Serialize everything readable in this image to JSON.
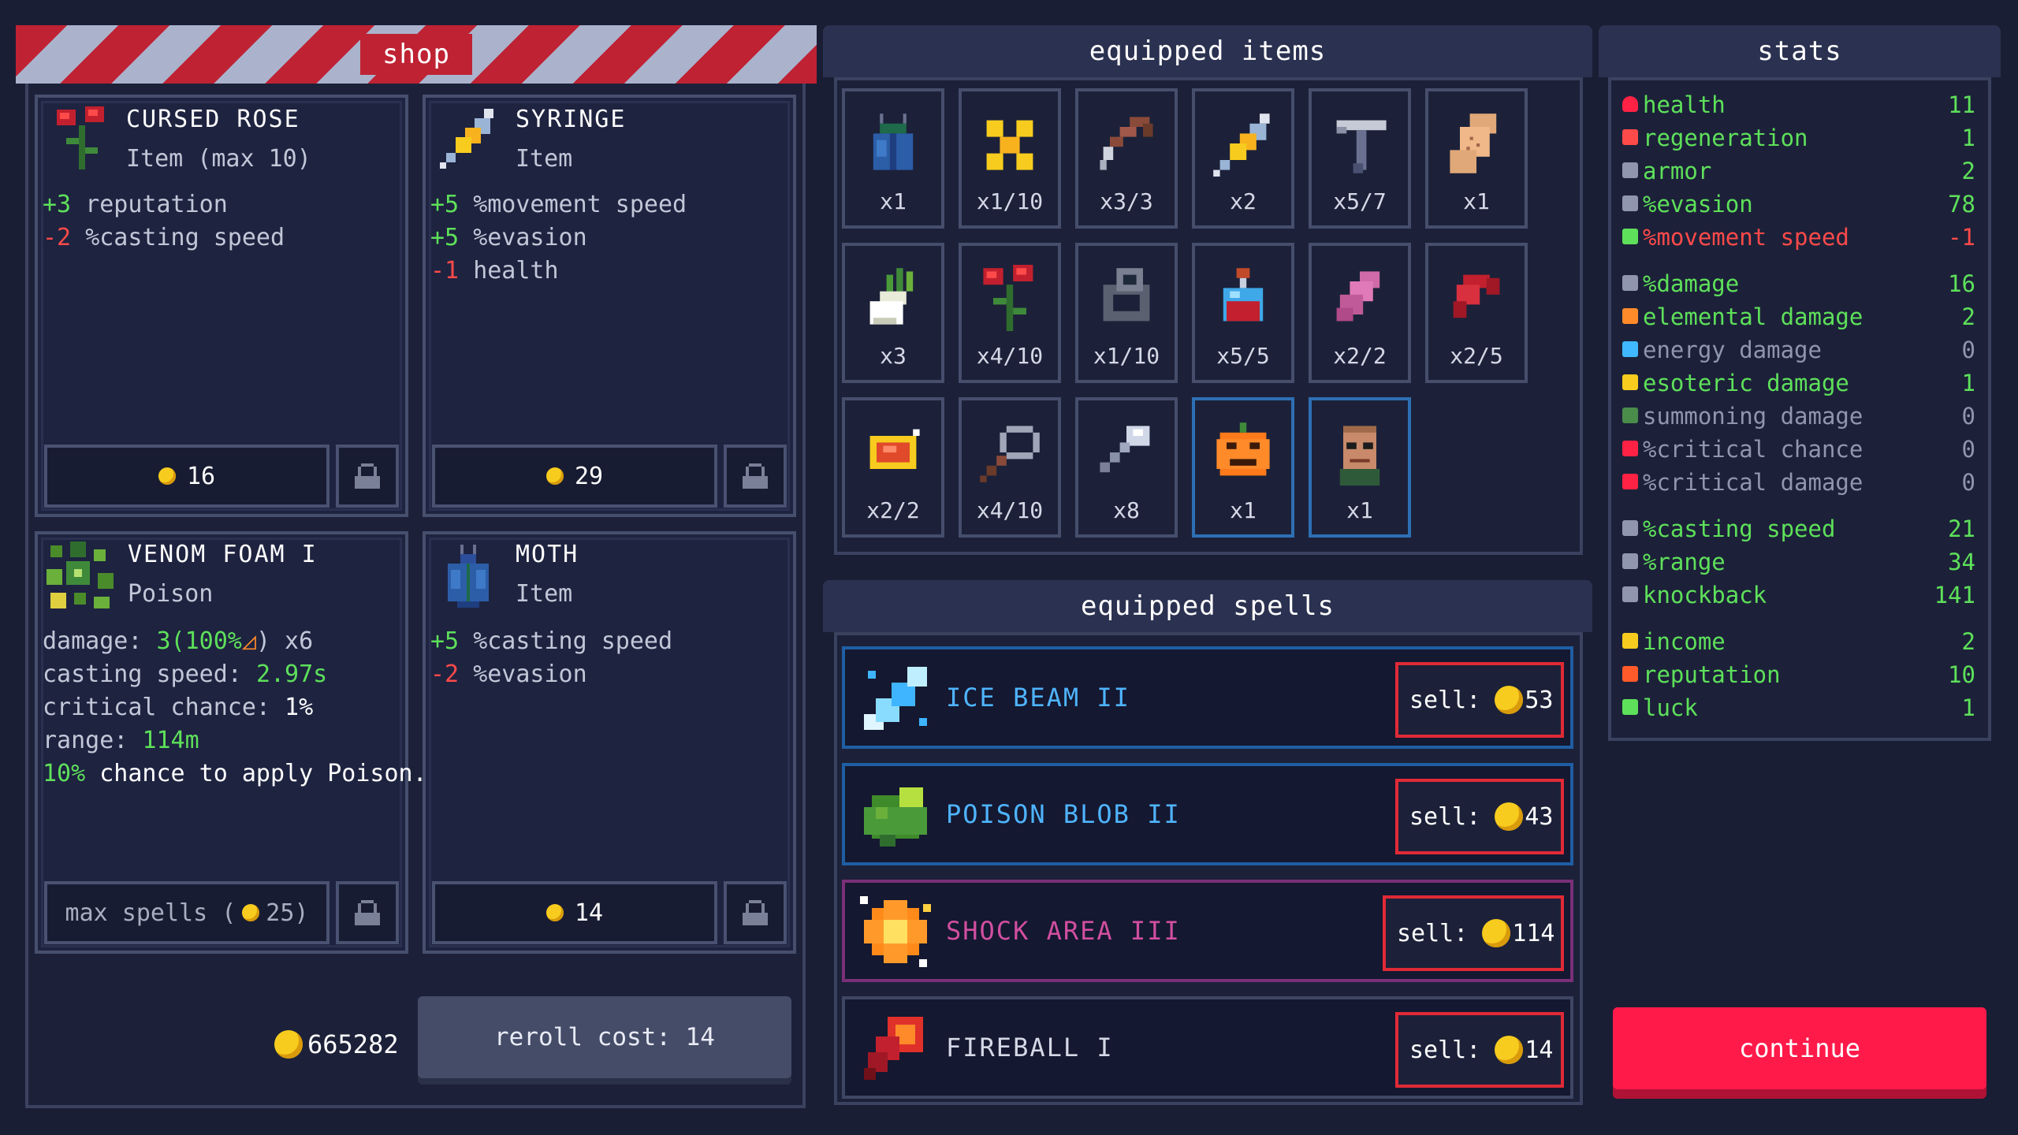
{
  "shop": {
    "title": "shop",
    "cards": [
      {
        "name": "CURSED ROSE",
        "type": "Item (max 10)",
        "effects": [
          {
            "sign": "+3",
            "text": "reputation",
            "kind": "pos"
          },
          {
            "sign": "-2",
            "text": "%casting speed",
            "kind": "neg"
          }
        ],
        "price": "16",
        "icon": "rose-icon"
      },
      {
        "name": "SYRINGE",
        "type": "Item",
        "effects": [
          {
            "sign": "+5",
            "text": "%movement speed",
            "kind": "pos"
          },
          {
            "sign": "+5",
            "text": "%evasion",
            "kind": "pos"
          },
          {
            "sign": "-1",
            "text": "health",
            "kind": "neg"
          }
        ],
        "price": "29",
        "icon": "syringe-icon"
      },
      {
        "name": "VENOM FOAM I",
        "type": "Poison",
        "lines": [
          {
            "label": "damage: ",
            "value": "3(100%",
            "after": ") x6"
          },
          {
            "label": "casting speed: ",
            "value": "2.97s",
            "after": ""
          },
          {
            "label": "critical chance: ",
            "value": "",
            "after": "1%"
          },
          {
            "label": "range: ",
            "value": "114m",
            "after": ""
          },
          {
            "label": "",
            "value": "10%",
            "after": " chance to apply Poison."
          }
        ],
        "max_spells_label": "max spells (",
        "max_spells_value": "25)",
        "icon": "venom-foam-icon"
      },
      {
        "name": "MOTH",
        "type": "Item",
        "effects": [
          {
            "sign": "+5",
            "text": "%casting speed",
            "kind": "pos"
          },
          {
            "sign": "-2",
            "text": "%evasion",
            "kind": "neg"
          }
        ],
        "price": "14",
        "icon": "moth-icon"
      }
    ],
    "gold": "665282",
    "reroll_label": "reroll cost: 14"
  },
  "equipped_items": {
    "title": "equipped items",
    "items": [
      {
        "icon": "beetle-icon",
        "count": "x1"
      },
      {
        "icon": "gold-dots-icon",
        "count": "x1/10"
      },
      {
        "icon": "horn-icon",
        "count": "x3/3"
      },
      {
        "icon": "syringe-icon",
        "count": "x2"
      },
      {
        "icon": "pickaxe-icon",
        "count": "x5/7"
      },
      {
        "icon": "bandage-icon",
        "count": "x1"
      },
      {
        "icon": "garlic-icon",
        "count": "x3"
      },
      {
        "icon": "rose-icon",
        "count": "x4/10"
      },
      {
        "icon": "ring-icon",
        "count": "x1/10"
      },
      {
        "icon": "potion-icon",
        "count": "x5/5"
      },
      {
        "icon": "eraser-icon",
        "count": "x2/2"
      },
      {
        "icon": "red-horn-icon",
        "count": "x2/5"
      },
      {
        "icon": "amulet-icon",
        "count": "x2/2"
      },
      {
        "icon": "magnifier-icon",
        "count": "x4/10"
      },
      {
        "icon": "spoon-icon",
        "count": "x8"
      },
      {
        "icon": "pumpkin-icon",
        "count": "x1"
      },
      {
        "icon": "character-portrait-icon",
        "count": "x1"
      }
    ]
  },
  "equipped_spells": {
    "title": "equipped spells",
    "sell_label": "sell:",
    "spells": [
      {
        "name": "ICE BEAM II",
        "price": "53",
        "color": "#4fb4ff",
        "border": "#1f5ea4",
        "icon": "ice-beam-icon"
      },
      {
        "name": "POISON BLOB II",
        "price": "43",
        "color": "#4fb4ff",
        "border": "#1f5ea4",
        "icon": "poison-blob-icon"
      },
      {
        "name": "SHOCK AREA III",
        "price": "114",
        "color": "#d14fa0",
        "border": "#7a2f78",
        "icon": "shock-area-icon"
      },
      {
        "name": "FIREBALL I",
        "price": "14",
        "color": "#d4d8e6",
        "border": "#3f4664",
        "icon": "fireball-icon"
      }
    ]
  },
  "stats": {
    "title": "stats",
    "rows": [
      {
        "label": "health",
        "value": "11",
        "kind": "g",
        "icon": "heart-icon",
        "color": "#ff2244"
      },
      {
        "label": "regeneration",
        "value": "1",
        "kind": "g",
        "icon": "regen-heart-icon",
        "color": "#ff4a4a"
      },
      {
        "label": "armor",
        "value": "2",
        "kind": "g",
        "icon": "shield-icon",
        "color": "#8f96ae"
      },
      {
        "label": "%evasion",
        "value": "78",
        "kind": "g",
        "icon": "evasion-icon",
        "color": "#8f96ae"
      },
      {
        "label": "%movement speed",
        "value": "-1",
        "kind": "r",
        "icon": "chevrons-icon",
        "color": "#5ee05a"
      },
      {
        "label": "%damage",
        "value": "16",
        "kind": "g",
        "icon": "damage-icon",
        "color": "#8f96ae"
      },
      {
        "label": "elemental damage",
        "value": "2",
        "kind": "g",
        "icon": "triangle-icon",
        "color": "#ff8a2a"
      },
      {
        "label": "energy damage",
        "value": "0",
        "kind": "d",
        "icon": "energy-icon",
        "color": "#3fb8ff"
      },
      {
        "label": "esoteric damage",
        "value": "1",
        "kind": "g",
        "icon": "esoteric-icon",
        "color": "#f7cc1e"
      },
      {
        "label": "summoning damage",
        "value": "0",
        "kind": "d",
        "icon": "summon-icon",
        "color": "#4a8c4a"
      },
      {
        "label": "%critical chance",
        "value": "0",
        "kind": "d",
        "icon": "crit-chance-icon",
        "color": "#ff2244"
      },
      {
        "label": "%critical damage",
        "value": "0",
        "kind": "d",
        "icon": "crit-damage-icon",
        "color": "#ff2244"
      },
      {
        "label": "%casting speed",
        "value": "21",
        "kind": "g",
        "icon": "wand-icon",
        "color": "#8f96ae"
      },
      {
        "label": "%range",
        "value": "34",
        "kind": "g",
        "icon": "range-icon",
        "color": "#8f96ae"
      },
      {
        "label": "knockback",
        "value": "141",
        "kind": "g",
        "icon": "knockback-icon",
        "color": "#8f96ae"
      },
      {
        "label": "income",
        "value": "2",
        "kind": "g",
        "icon": "income-icon",
        "color": "#f7cc1e"
      },
      {
        "label": "reputation",
        "value": "10",
        "kind": "g",
        "icon": "medal-icon",
        "color": "#ff5a2a"
      },
      {
        "label": "luck",
        "value": "1",
        "kind": "g",
        "icon": "rainbow-icon",
        "color": "#5ee05a"
      }
    ]
  },
  "continue_label": "continue"
}
